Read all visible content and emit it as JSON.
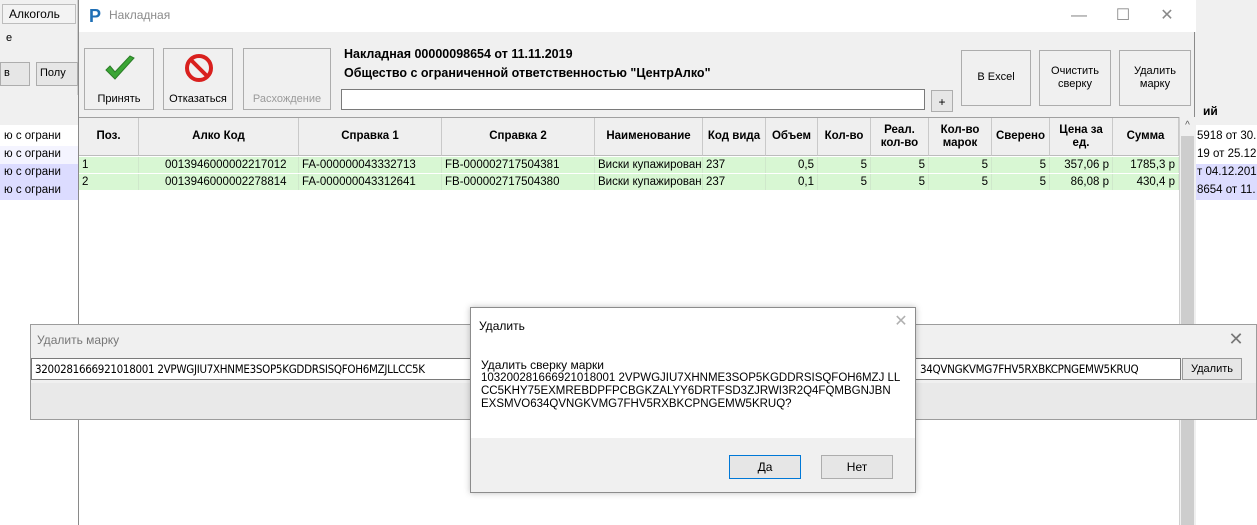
{
  "background": {
    "tab_label": "Алкоголь",
    "left_labels": [
      "е",
      "в",
      "Полу"
    ],
    "rows": [
      "ю с ограни",
      "ю с ограни",
      "ю с ограни",
      "ю с ограни"
    ],
    "right_header": "ий",
    "right_rows": [
      "5918 от 30.",
      "19 от 25.12",
      "т 04.12.201",
      "8654 от 11."
    ]
  },
  "window": {
    "title": "Накладная",
    "controls": [
      "—",
      "☐",
      "✕"
    ]
  },
  "toolbar": {
    "accept_label": "Принять",
    "refuse_label": "Отказаться",
    "discrepancy_label": "Расхождение",
    "excel_label": "В Excel",
    "clear_label": "Очистить сверку",
    "delete_mark_label": "Удалить марку"
  },
  "header": {
    "line1": "Накладная 00000098654 от 11.11.2019",
    "line2": "Общество с ограниченной ответственностью \"ЦентрАлко\"",
    "search_value": "",
    "plus_label": "+"
  },
  "grid": {
    "columns": [
      "Поз.",
      "Алко Код",
      "Справка 1",
      "Справка 2",
      "Наименование",
      "Код вида",
      "Объем",
      "Кол-во",
      "Реал. кол-во",
      "Кол-во марок",
      "Сверено",
      "Цена за ед.",
      "Сумма"
    ],
    "rows": [
      [
        "1",
        "0013946000002217012",
        "FA-000000043332713",
        "FB-000002717504381",
        "Виски купажирован",
        "237",
        "0,5",
        "5",
        "5",
        "5",
        "5",
        "357,06 р",
        "1785,3 р"
      ],
      [
        "2",
        "0013946000002278814",
        "FA-000000043312641",
        "FB-000002717504380",
        "Виски купажирован",
        "237",
        "0,1",
        "5",
        "5",
        "5",
        "5",
        "86,08 р",
        "430,4 р"
      ]
    ],
    "scroll_up": "^"
  },
  "delete_mark_panel": {
    "title": "Удалить марку",
    "close": "✕",
    "input_value": "3200281666921018001 2VPWGJIU7XHNME3SOP5KGDDRSISQFOH6MZJLLCC5K",
    "input_value_tail": "34QVNGKVMG7FHV5RXBKCPNGEMW5KRUQ",
    "button_label": "Удалить"
  },
  "confirm_dialog": {
    "title": "Удалить",
    "close": "✕",
    "message_title": "Удалить сверку марки",
    "message": "103200281666921018001 2VPWGJIU7XHNME3SOP5KGDDRSISQFOH6MZJ LLCC5KHY75EXMREBDPFPCBGKZALYY6DRTFSD3ZJRWI3R2Q4FQMBGNJBN EXSMVO634QVNGKVMG7FHV5RXBKCPNGEMW5KRUQ?",
    "yes_label": "Да",
    "no_label": "Нет"
  },
  "colors": {
    "row_highlight": "#d8f7d3",
    "accept_check": "#3aa635",
    "refuse_icon": "#d9201e",
    "focus_border": "#0078d7"
  }
}
